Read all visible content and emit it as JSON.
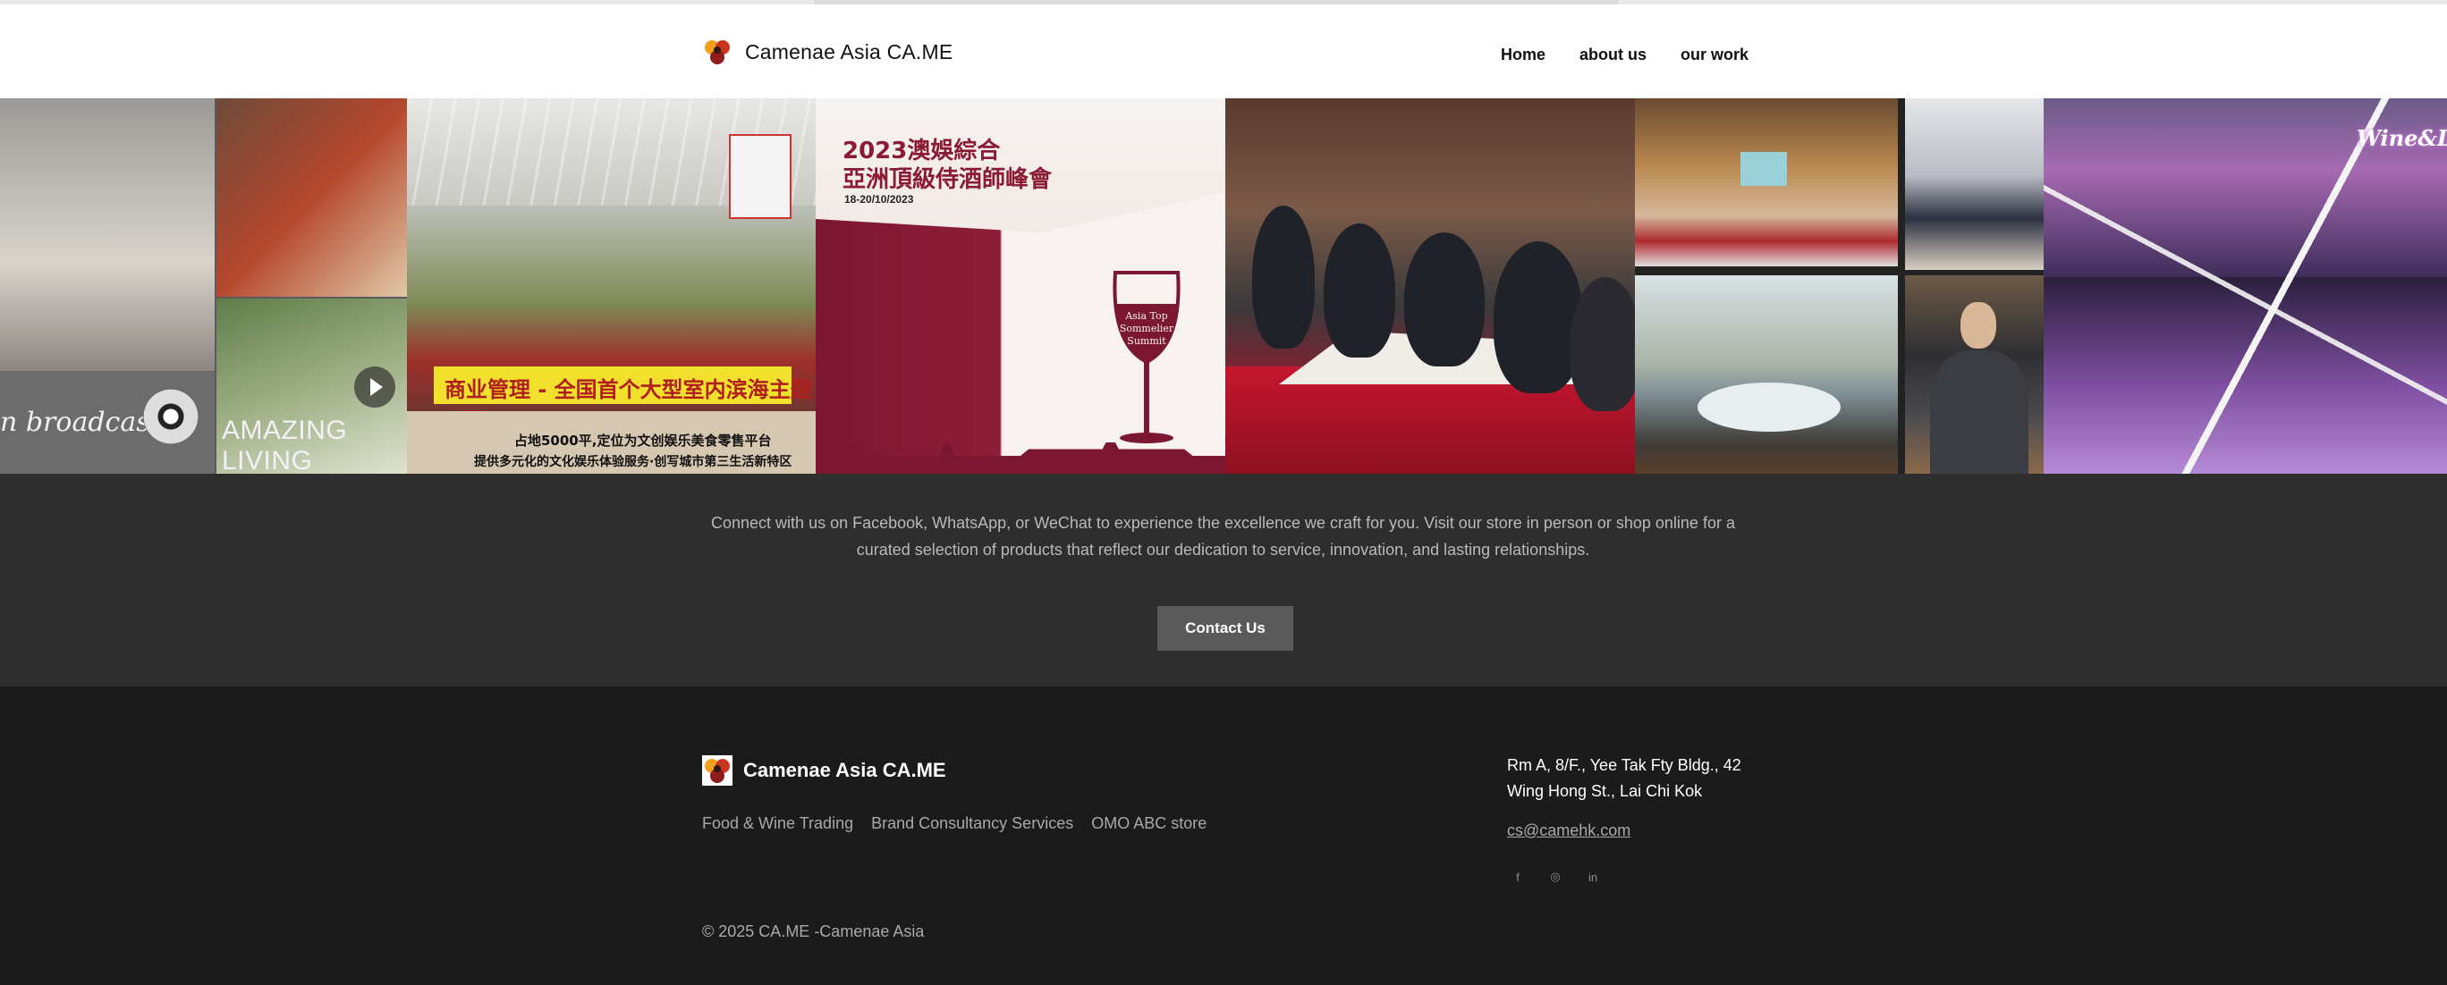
{
  "header": {
    "brand_name": "Camenae Asia CA.ME",
    "nav": [
      "Home",
      "about us",
      "our work"
    ]
  },
  "gallery": {
    "tile1": {
      "broadcast_text": "n broadcast",
      "amazing_text": "AMAZING LIVING"
    },
    "tile2": {
      "banner_text": "商业管理 - 全国首个大型室内滨海主题乐园",
      "sub1": "占地5000平,定位为文创娱乐美食零售平台",
      "sub2": "提供多元化的文化娱乐体验服务·创写城市第三生活新特区"
    },
    "tile3": {
      "year_title": "2023澳娛綜合",
      "cn_title": "亞洲頂級侍酒師峰會",
      "date": "18-20/10/2023",
      "glass_text": [
        "Asia Top",
        "Sommelier",
        "Summit"
      ]
    },
    "tile7": {
      "sign_text": "Wine&Di"
    }
  },
  "cta": {
    "text": "Connect with us on Facebook, WhatsApp, or WeChat to experience the excellence we craft for you. Visit our store in person or shop online  for a curated selection of products that reflect our dedication to service, innovation, and lasting relationships.",
    "button_label": "Contact Us"
  },
  "footer": {
    "brand_name": "Camenae Asia CA.ME",
    "links": [
      "Food & Wine Trading",
      "Brand Consultancy Services",
      "OMO ABC store"
    ],
    "address_line1": "Rm A, 8/F., Yee Tak Fty Bldg., 42",
    "address_line2": "Wing Hong St., Lai Chi Kok",
    "email": "cs@camehk.com",
    "social": [
      {
        "icon": "facebook-icon",
        "glyph": "f"
      },
      {
        "icon": "instagram-icon",
        "glyph": "◎"
      },
      {
        "icon": "linkedin-icon",
        "glyph": "in"
      }
    ],
    "copyright": "© 2025 CA.ME -Camenae Asia"
  },
  "colors": {
    "cta_band": "#2e2e2e",
    "footer_band": "#1b1b1b",
    "button": "#5a5a5a",
    "logo_red": "#c8361f",
    "logo_orange": "#f2a01b"
  }
}
